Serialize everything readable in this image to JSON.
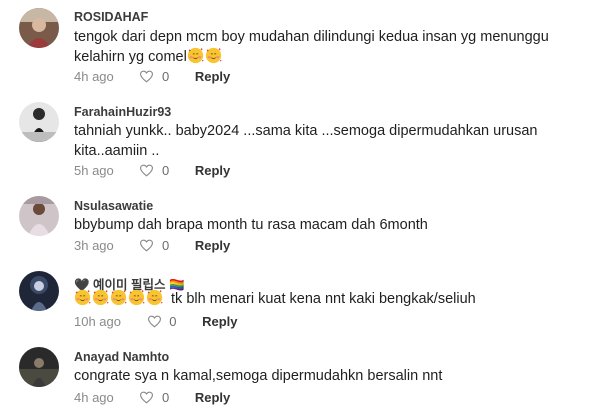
{
  "comments": [
    {
      "username": "ROSIDAHAF",
      "text": "tengok dari depn mcm boy mudahan dilindungi kedua insan yg menunggu kelahirn yg comel",
      "emoji_count": 2,
      "time": "4h ago",
      "likes": "0",
      "reply": "Reply"
    },
    {
      "username": "FarahainHuzir93",
      "text": "tahniah yunkk.. baby2024 ...sama kita ...semoga dipermudahkan urusan kita..aamiin ..",
      "emoji_count": 0,
      "time": "5h ago",
      "likes": "0",
      "reply": "Reply"
    },
    {
      "username": "Nsulasawatie",
      "text": "bbybump dah brapa month tu rasa macam dah 6month",
      "emoji_count": 0,
      "time": "3h ago",
      "likes": "0",
      "reply": "Reply"
    },
    {
      "username": "🖤 예이미 필립스 🏳️‍🌈",
      "text": "tk blh menari kuat kena nnt kaki bengkak/seliuh",
      "emoji_count": 5,
      "time": "10h ago",
      "likes": "0",
      "reply": "Reply"
    },
    {
      "username": "Anayad Namhto",
      "text": "congrate sya n kamal,semoga dipermudahkn bersalin nnt",
      "emoji_count": 0,
      "time": "4h ago",
      "likes": "0",
      "reply": "Reply"
    }
  ],
  "icons": {
    "like": "heart-outline-icon",
    "emoji": "smiling-face-with-hearts-emoji"
  },
  "colors": {
    "username": "#3b3b3b",
    "meta": "#8a8a8a",
    "text": "#1f1f1f"
  }
}
